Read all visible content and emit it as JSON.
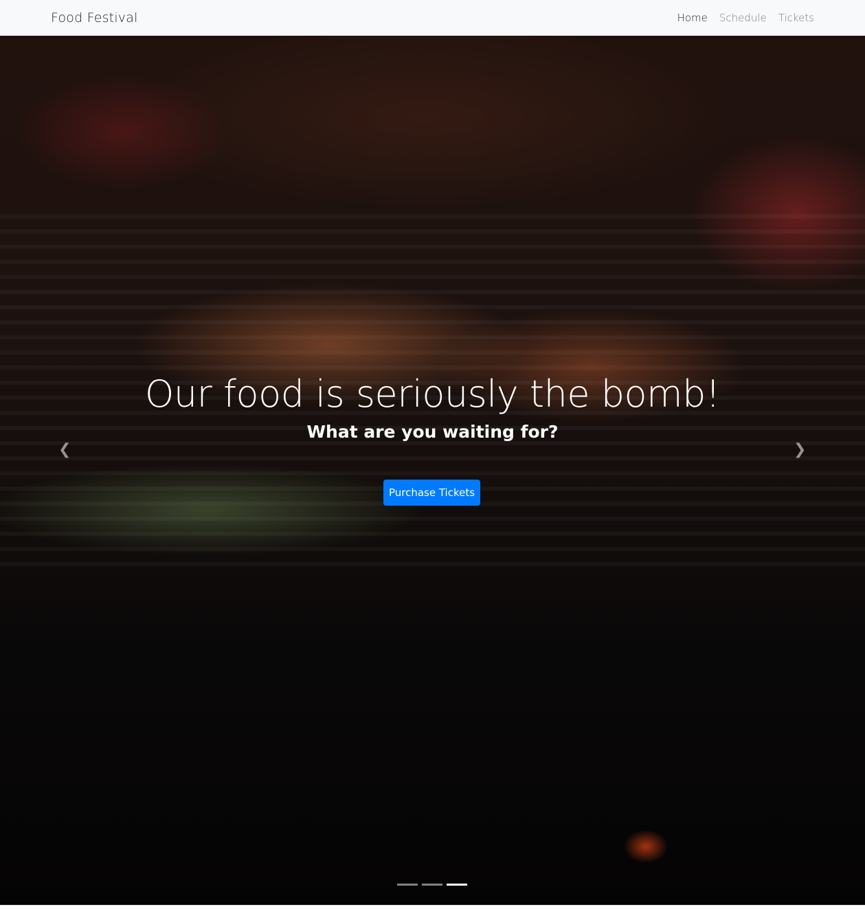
{
  "navbar": {
    "brand": "Food Festival",
    "links": [
      {
        "label": "Home",
        "active": true
      },
      {
        "label": "Schedule",
        "active": false
      },
      {
        "label": "Tickets",
        "active": false
      }
    ]
  },
  "hero": {
    "headline": "Our food is seriously the bomb!",
    "subheadline": "What are you waiting for?",
    "cta_label": "Purchase Tickets",
    "prev_icon": "chevron-left-icon",
    "next_icon": "chevron-right-icon",
    "slide_count": 3,
    "active_slide": 3
  },
  "colors": {
    "primary": "#007bff",
    "navbar_bg": "#f8f9fa"
  }
}
